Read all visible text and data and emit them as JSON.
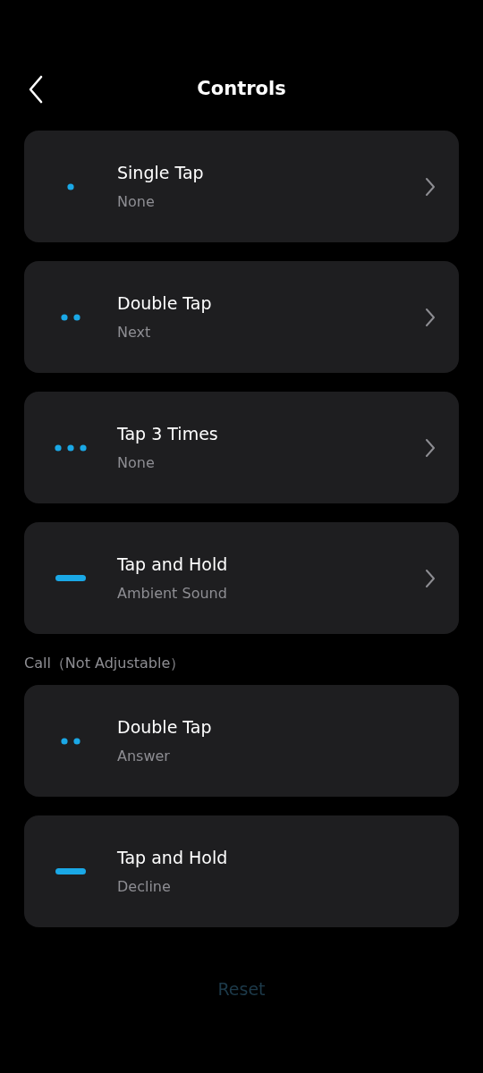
{
  "header": {
    "title": "Controls"
  },
  "controls": [
    {
      "kind": "single",
      "title": "Single Tap",
      "value": "None",
      "adjustable": true
    },
    {
      "kind": "double",
      "title": "Double Tap",
      "value": "Next",
      "adjustable": true
    },
    {
      "kind": "triple",
      "title": "Tap 3 Times",
      "value": "None",
      "adjustable": true
    },
    {
      "kind": "hold",
      "title": "Tap and Hold",
      "value": "Ambient Sound",
      "adjustable": true
    }
  ],
  "call_section": {
    "label": "Call（Not Adjustable）",
    "items": [
      {
        "kind": "double",
        "title": "Double Tap",
        "value": "Answer",
        "adjustable": false
      },
      {
        "kind": "hold",
        "title": "Tap and Hold",
        "value": "Decline",
        "adjustable": false
      }
    ]
  },
  "reset_button": {
    "label": "Reset",
    "disabled": true
  }
}
